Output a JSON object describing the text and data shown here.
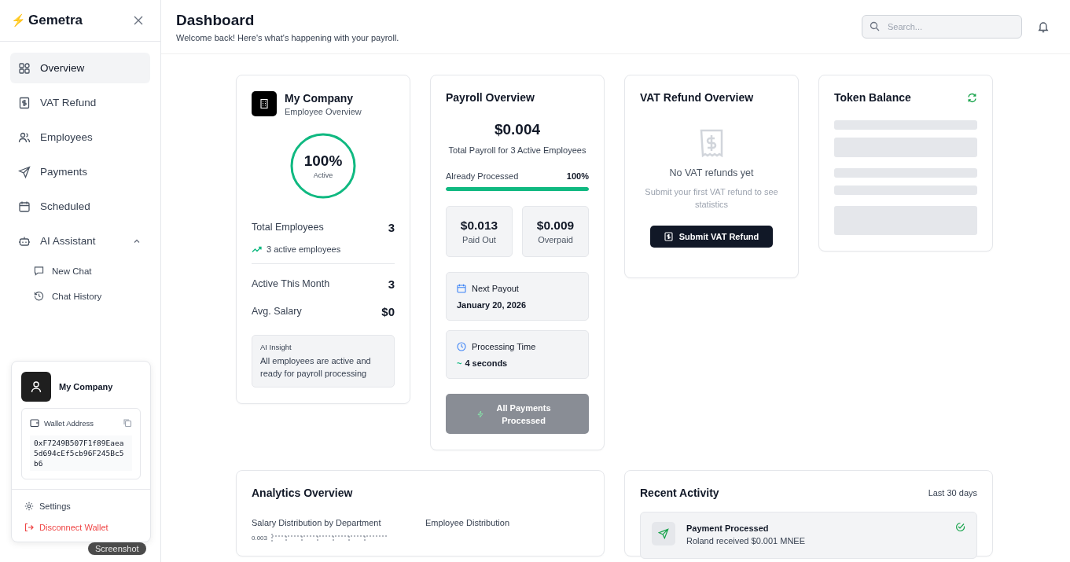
{
  "sidebar": {
    "brand_mark": "⚡",
    "brand": "Gemetra",
    "nav": [
      {
        "label": "Overview",
        "selected": true
      },
      {
        "label": "VAT Refund",
        "selected": false
      },
      {
        "label": "Employees",
        "selected": false
      },
      {
        "label": "Payments",
        "selected": false
      },
      {
        "label": "Scheduled",
        "selected": false
      },
      {
        "label": "AI Assistant",
        "selected": false,
        "expanded": true,
        "children": [
          {
            "label": "New Chat"
          },
          {
            "label": "Chat History"
          }
        ]
      }
    ]
  },
  "account_popover": {
    "name": "My Company",
    "wallet_label": "Wallet Address",
    "wallet_address": "0xF7249B507F1f89Eaea5d694cEf5cb96F245Bc5b6",
    "actions": [
      {
        "label": "Settings",
        "kind": "normal"
      },
      {
        "label": "Disconnect Wallet",
        "kind": "danger"
      }
    ]
  },
  "tooltip": "Screenshot",
  "header": {
    "title": "Dashboard",
    "subtitle": "Welcome back! Here's what's happening with your payroll.",
    "search": {
      "placeholder": "Search..."
    }
  },
  "company_card": {
    "title": "My Company",
    "subtitle": "Employee Overview",
    "ring": {
      "value": "100%",
      "label": "Active",
      "level": 1
    },
    "total": {
      "label": "Total Employees",
      "value": "3"
    },
    "trend": "3 active employees",
    "stats": [
      {
        "label": "Active This Month",
        "value": "3"
      },
      {
        "label": "Avg. Salary",
        "value": "$0"
      }
    ],
    "insight": {
      "title": "AI Insight",
      "text": "All employees are active and ready for payroll processing"
    }
  },
  "payroll_card": {
    "title": "Payroll Overview",
    "amount": "$0.004",
    "caption": "Total Payroll for 3 Active Employees",
    "progress": {
      "label": "Already Processed",
      "reading": "100%",
      "level": 1
    },
    "tiles": [
      {
        "value": "$0.013",
        "label": "Paid Out"
      },
      {
        "value": "$0.009",
        "label": "Overpaid"
      }
    ],
    "infos": [
      {
        "label": "Next Payout",
        "value": "January 20, 2026"
      },
      {
        "label": "Processing Time",
        "value": "4 seconds",
        "prefix": "~"
      }
    ],
    "button": {
      "label": "All Payments Processed",
      "disabled": true
    }
  },
  "vat_card": {
    "title": "VAT Refund Overview",
    "empty_title": "No VAT refunds yet",
    "empty_text": "Submit your first VAT refund to see statistics",
    "button": "Submit VAT Refund"
  },
  "token_card": {
    "title": "Token Balance",
    "loading": true
  },
  "analytics_card": {
    "title": "Analytics Overview",
    "charts": [
      {
        "title": "Salary Distribution by Department",
        "tick": "0.003"
      },
      {
        "title": "Employee Distribution"
      }
    ]
  },
  "activity_card": {
    "title": "Recent Activity",
    "range": "Last 30 days",
    "items": [
      {
        "title": "Payment Processed",
        "text": "Roland received $0.001 MNEE",
        "done": true
      }
    ]
  }
}
